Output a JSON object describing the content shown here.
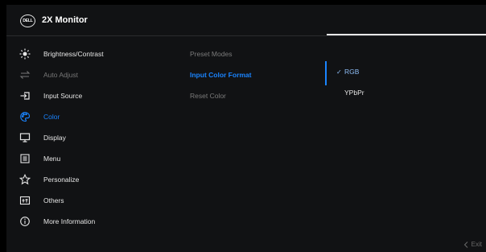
{
  "header": {
    "logo_text": "DELL",
    "title": "2X Monitor"
  },
  "menu": [
    {
      "label": "Brightness/Contrast",
      "icon": "brightness-icon",
      "state": "normal"
    },
    {
      "label": "Auto Adjust",
      "icon": "auto-adjust-icon",
      "state": "disabled"
    },
    {
      "label": "Input Source",
      "icon": "input-source-icon",
      "state": "normal"
    },
    {
      "label": "Color",
      "icon": "color-palette-icon",
      "state": "active"
    },
    {
      "label": "Display",
      "icon": "display-icon",
      "state": "normal"
    },
    {
      "label": "Menu",
      "icon": "menu-icon",
      "state": "normal"
    },
    {
      "label": "Personalize",
      "icon": "star-icon",
      "state": "normal"
    },
    {
      "label": "Others",
      "icon": "others-icon",
      "state": "normal"
    },
    {
      "label": "More Information",
      "icon": "info-icon",
      "state": "normal"
    }
  ],
  "submenu": [
    {
      "label": "Preset Modes",
      "state": "dim"
    },
    {
      "label": "Input Color Format",
      "state": "active"
    },
    {
      "label": "Reset Color",
      "state": "dim"
    }
  ],
  "options": [
    {
      "label": "RGB",
      "selected": true
    },
    {
      "label": "YPbPr",
      "selected": false
    }
  ],
  "footer": {
    "exit_label": "Exit",
    "exit_icon": "chevron-left-icon"
  },
  "colors": {
    "accent": "#1a84ff",
    "selected": "#8dbcf5",
    "disabled": "#777777",
    "background": "#111214"
  }
}
